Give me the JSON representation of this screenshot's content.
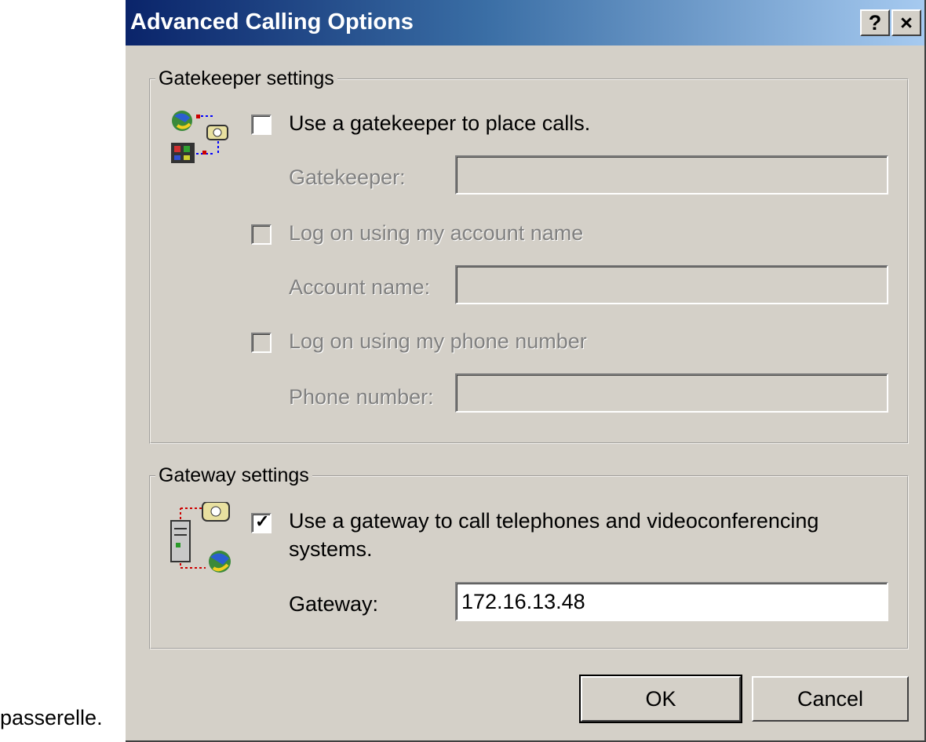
{
  "caption": "passerelle.",
  "window": {
    "title": "Advanced Calling Options",
    "help_label": "?",
    "close_label": "×"
  },
  "gatekeeper": {
    "legend": "Gatekeeper settings",
    "use_label": "Use a gatekeeper to place calls.",
    "use_checked": false,
    "gatekeeper_label": "Gatekeeper:",
    "gatekeeper_value": "",
    "logon_account_label": "Log on using my account name",
    "account_label": "Account name:",
    "account_value": "",
    "logon_phone_label": "Log on using my phone number",
    "phone_label": "Phone number:",
    "phone_value": ""
  },
  "gateway": {
    "legend": "Gateway settings",
    "use_label_line1": "Use a gateway to call telephones and videoconferencing",
    "use_label_line2": "systems.",
    "use_checked": true,
    "check_mark": "✓",
    "gateway_label": "Gateway:",
    "gateway_value": "172.16.13.48"
  },
  "buttons": {
    "ok": "OK",
    "cancel": "Cancel"
  }
}
